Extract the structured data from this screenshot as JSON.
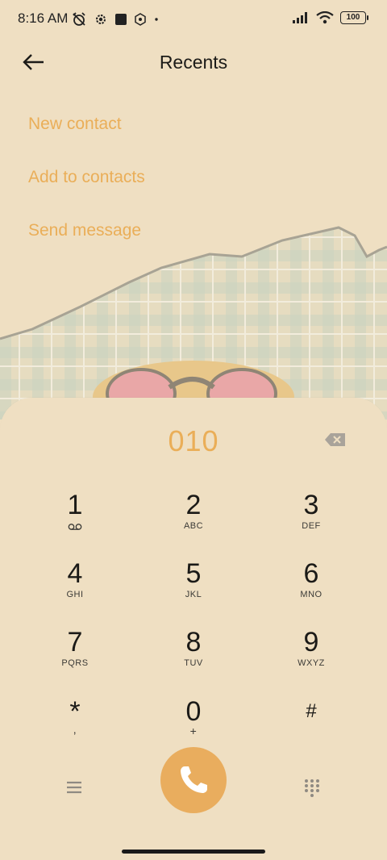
{
  "status_bar": {
    "time": "8:16 AM",
    "battery": "100"
  },
  "header": {
    "title": "Recents",
    "back_icon": "arrow-left-icon"
  },
  "actions": {
    "new_contact": "New contact",
    "add_to_contacts": "Add to contacts",
    "send_message": "Send message"
  },
  "dialer": {
    "number": "010",
    "keys": [
      {
        "digit": "1",
        "letters": ""
      },
      {
        "digit": "2",
        "letters": "ABC"
      },
      {
        "digit": "3",
        "letters": "DEF"
      },
      {
        "digit": "4",
        "letters": "GHI"
      },
      {
        "digit": "5",
        "letters": "JKL"
      },
      {
        "digit": "6",
        "letters": "MNO"
      },
      {
        "digit": "7",
        "letters": "PQRS"
      },
      {
        "digit": "8",
        "letters": "TUV"
      },
      {
        "digit": "9",
        "letters": "WXYZ"
      },
      {
        "digit": "*",
        "letters": ","
      },
      {
        "digit": "0",
        "letters": "+"
      },
      {
        "digit": "#",
        "letters": ""
      }
    ]
  },
  "colors": {
    "accent": "#eaae58",
    "background": "#efdfc2",
    "call_button": "#e9ad5e"
  }
}
